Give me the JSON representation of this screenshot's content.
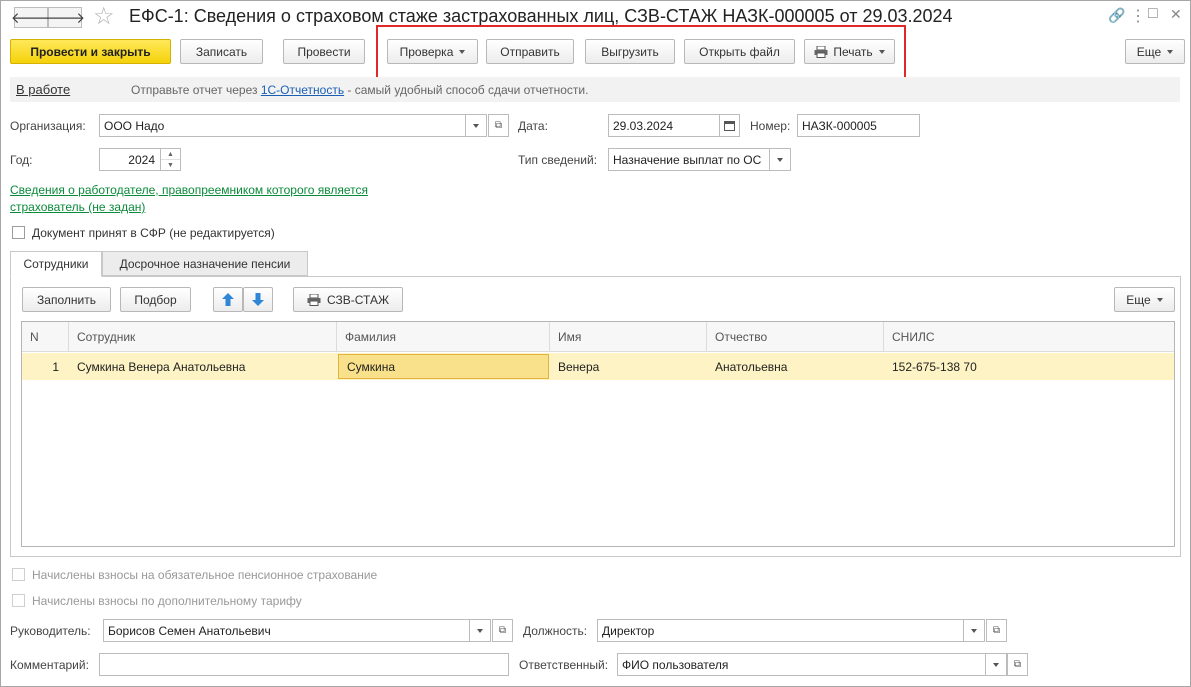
{
  "window": {
    "title": "ЕФС-1: Сведения о страховом стаже застрахованных лиц, СЗВ-СТАЖ НАЗК-000005 от 29.03.2024",
    "back_glyph": "🡐",
    "forward_glyph": "🡒",
    "star_glyph": "☆",
    "link_glyph": "🔗",
    "more_glyph": "⋮",
    "max_glyph": "□",
    "close_glyph": "✕"
  },
  "toolbar": {
    "post_close": "Провести и закрыть",
    "write": "Записать",
    "post": "Провести",
    "check": "Проверка",
    "send": "Отправить",
    "upload": "Выгрузить",
    "open_file": "Открыть файл",
    "print": "Печать",
    "more": "Еще"
  },
  "status": {
    "state": "В работе",
    "hint_prefix": "Отправьте отчет через ",
    "hint_link": "1С-Отчетность",
    "hint_suffix": " - самый удобный способ сдачи отчетности."
  },
  "form": {
    "org_label": "Организация:",
    "org_value": "ООО Надо",
    "date_label": "Дата:",
    "date_value": "29.03.2024",
    "number_label": "Номер:",
    "number_value": "НАЗК-000005",
    "year_label": "Год:",
    "year_value": "2024",
    "type_label": "Тип сведений:",
    "type_value": "Назначение выплат по ОС",
    "employer_link_line1": "Сведения о работодателе, правопреемником которого является",
    "employer_link_line2": "страхователь (не задан)",
    "accepted_label": "Документ принят в СФР (не редактируется)"
  },
  "tabs": [
    {
      "label": "Сотрудники"
    },
    {
      "label": "Досрочное назначение пенсии"
    }
  ],
  "table_toolbar": {
    "fill": "Заполнить",
    "select": "Подбор",
    "report": "СЗВ-СТАЖ",
    "more": "Еще"
  },
  "table": {
    "columns": [
      "N",
      "Сотрудник",
      "Фамилия",
      "Имя",
      "Отчество",
      "СНИЛС"
    ],
    "rows": [
      [
        "1",
        "Сумкина Венера Анатольевна",
        "Сумкина",
        "Венера",
        "Анатольевна",
        "152-675-138 70"
      ]
    ]
  },
  "bottom": {
    "chk_mandatory": "Начислены взносы на обязательное пенсионное страхование",
    "chk_additional": "Начислены взносы по дополнительному тарифу",
    "head_label": "Руководитель:",
    "head_value": "Борисов Семен Анатольевич",
    "position_label": "Должность:",
    "position_value": "Директор",
    "comment_label": "Комментарий:",
    "comment_value": "",
    "responsible_label": "Ответственный:",
    "responsible_value": "ФИО пользователя"
  },
  "colors": {
    "primary_button": "#f5d20a",
    "highlight_row": "#fdf3c4",
    "selected_cell": "#f9e08a",
    "annotation_box": "#e0272a",
    "link_green": "#0a8a3a",
    "link_blue": "#1a5fb4"
  }
}
